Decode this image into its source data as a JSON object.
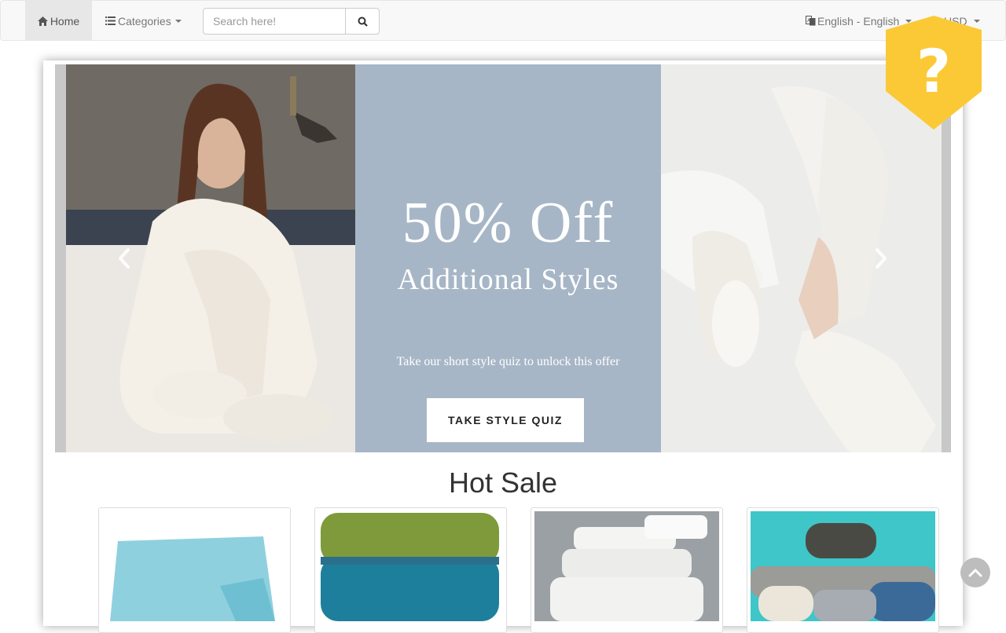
{
  "navbar": {
    "home_label": "Home",
    "categories_label": "Categories",
    "search_placeholder": "Search here!",
    "language_label": "English - English",
    "currency_label": "USD"
  },
  "carousel": {
    "headline": "50% Off",
    "subheadline": "Additional Styles",
    "tagline": "Take our short style quiz to unlock this offer",
    "cta_label": "TAKE STYLE QUIZ"
  },
  "hot_sale": {
    "title": "Hot Sale",
    "products": [
      {
        "name": "light-blue-towel"
      },
      {
        "name": "green-teal-towels"
      },
      {
        "name": "white-towel-stack"
      },
      {
        "name": "assorted-towels"
      }
    ]
  },
  "colors": {
    "accent_badge": "#fbc935",
    "promo_panel": "#a7b6c6",
    "nav_bg": "#f8f8f8"
  },
  "icons": [
    "home-icon",
    "list-icon",
    "search-icon",
    "language-icon",
    "currency-icon",
    "question-icon",
    "chevron-left-icon",
    "chevron-right-icon",
    "chevron-up-icon"
  ]
}
